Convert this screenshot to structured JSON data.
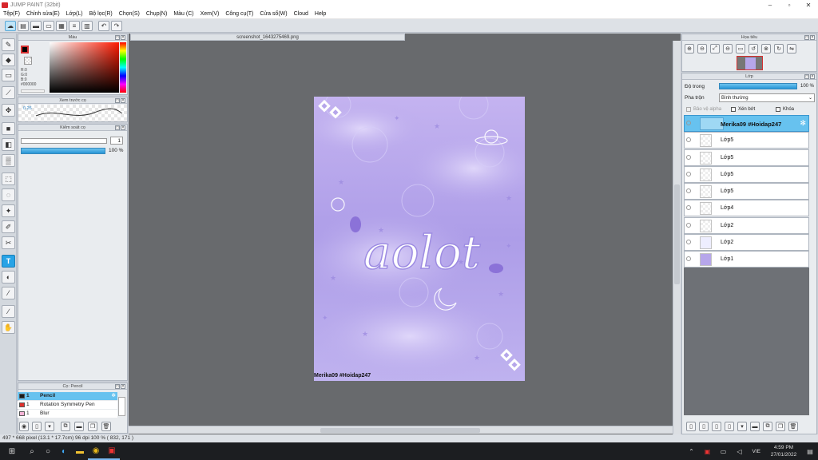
{
  "app": {
    "title": "JUMP PAINT (32bit)"
  },
  "menu": [
    "Tệp(F)",
    "Chỉnh sửa(E)",
    "Lớp(L)",
    "Bộ lọc(R)",
    "Chọn(S)",
    "Chụp(N)",
    "Màu (C)",
    "Xem(V)",
    "Công cụ(T)",
    "Cửa sổ(W)",
    "Cloud",
    "Help"
  ],
  "color_panel": {
    "title": "Màu",
    "r": "R:0",
    "g": "G:0",
    "b": "B:0",
    "hex": "#000000"
  },
  "preview_panel": {
    "title": "Xem trước cọ",
    "size": "0.26"
  },
  "brush_control": {
    "title": "Kiểm soát cọ",
    "size_value": "1",
    "opacity": "100 %"
  },
  "document_tab": {
    "name": "screenshot_1643275469.png"
  },
  "canvas": {
    "caption": "Merika09 #Hoidap247",
    "art_text": "aolot"
  },
  "navigator": {
    "title": "Họa tiêu"
  },
  "layers_panel": {
    "title": "Lớp",
    "opacity_label": "Độ trong",
    "opacity_value": "100 %",
    "blend_label": "Pha trộn",
    "blend_value": "Bình thường",
    "protect_alpha": "Bảo vệ alpha",
    "clip": "Xén bớt",
    "lock": "Khóa"
  },
  "layers": [
    {
      "name": "Merika09 #Hoidap247",
      "active": true
    },
    {
      "name": "Lớp5"
    },
    {
      "name": "Lớp5"
    },
    {
      "name": "Lớp5"
    },
    {
      "name": "Lớp5"
    },
    {
      "name": "Lớp4"
    },
    {
      "name": "Lớp2"
    },
    {
      "name": "Lớp2"
    },
    {
      "name": "Lớp1"
    }
  ],
  "brush_panel": {
    "title": "Cọ: Pencil",
    "items": [
      {
        "num": "1",
        "name": "Pencil",
        "color": "#1a1a1a"
      },
      {
        "num": "1",
        "name": "Rotation Symmetry Pen",
        "color": "#e0302c"
      },
      {
        "num": "1",
        "name": "Blur",
        "color": "#f5b3d6"
      }
    ]
  },
  "status": {
    "text": "497 * 668 pixel   (13.1 * 17.7cm)   96 dpi   100 %   ( 832, 171 )"
  },
  "taskbar": {
    "lang": "VIE",
    "time": "4:59 PM",
    "date": "27/01/2022"
  },
  "colors": {
    "accent": "#27a3e6",
    "canvas": "#b6a6ea",
    "workspace": "#686a6d"
  }
}
